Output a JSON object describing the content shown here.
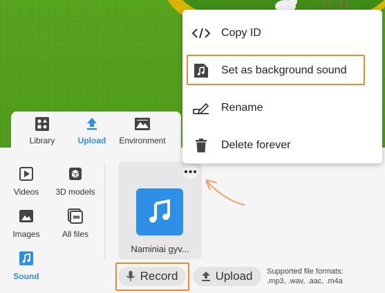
{
  "tabs": [
    {
      "label": "Library",
      "icon": "library-icon"
    },
    {
      "label": "Upload",
      "icon": "upload-icon",
      "active": true
    },
    {
      "label": "Environment",
      "icon": "environment-icon"
    }
  ],
  "sidebar": [
    {
      "label": "Videos",
      "icon": "video-icon"
    },
    {
      "label": "3D models",
      "icon": "cube-icon"
    },
    {
      "label": "Images",
      "icon": "image-icon"
    },
    {
      "label": "All files",
      "icon": "infinity-icon"
    },
    {
      "label": "Sound",
      "icon": "music-icon",
      "active": true
    }
  ],
  "file_card": {
    "name": "Naminiai gyv...",
    "icon": "music-note-icon",
    "more": "•••"
  },
  "actions": {
    "record_label": "Record",
    "upload_label": "Upload"
  },
  "formats": {
    "line1": "Supported file formats:",
    "line2": ".mp3, .wav, .aac, .m4a"
  },
  "context_menu": [
    {
      "label": "Copy ID",
      "icon": "code-icon"
    },
    {
      "label": "Set as background sound",
      "icon": "music-file-icon",
      "highlighted": true
    },
    {
      "label": "Rename",
      "icon": "edit-icon"
    },
    {
      "label": "Delete forever",
      "icon": "trash-icon"
    }
  ],
  "colors": {
    "accent": "#2d8fe6",
    "highlight": "#e98b2f",
    "grass": "#4e9a1a",
    "platform": "#d9b400"
  }
}
